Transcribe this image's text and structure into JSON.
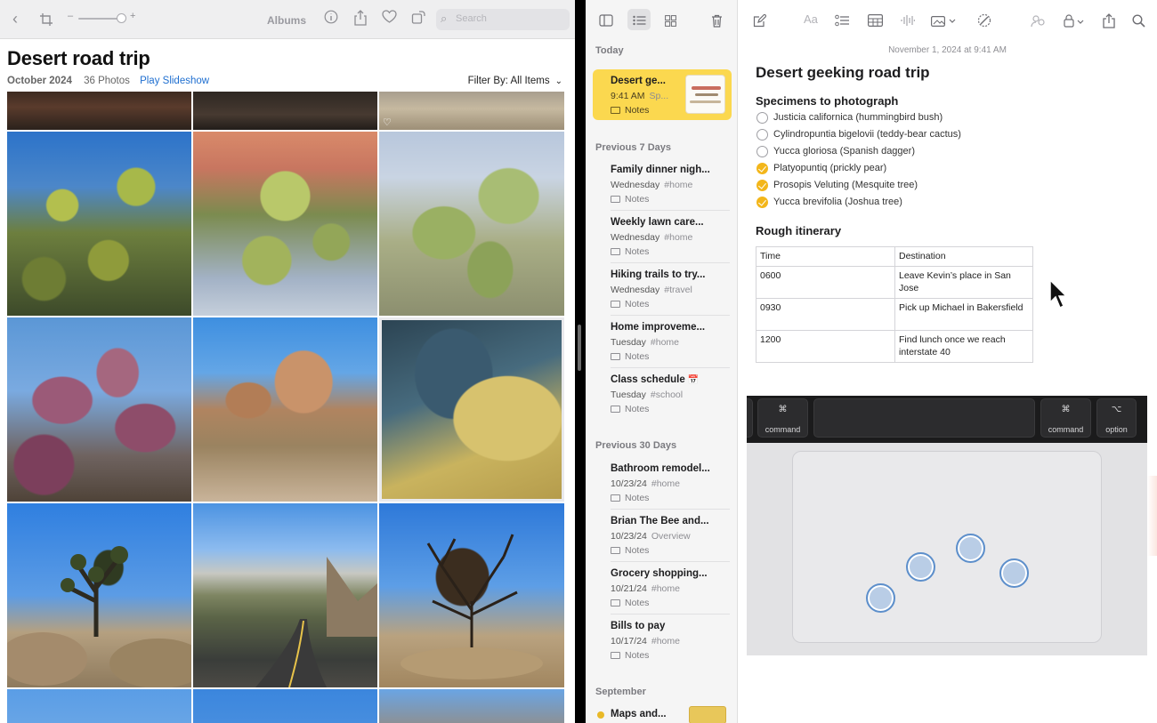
{
  "photos": {
    "toolbar": {
      "albums_label": "Albums",
      "search_placeholder": "Search"
    },
    "title": "Desert road trip",
    "date": "October 2024",
    "count": "36 Photos",
    "slideshow_label": "Play Slideshow",
    "filter_label": "Filter By: All Items"
  },
  "notes": {
    "sections": {
      "today": "Today",
      "prev7": "Previous 7 Days",
      "prev30": "Previous 30 Days",
      "september": "September"
    },
    "items": [
      {
        "title": "Desert ge...",
        "date": "9:41 AM",
        "tag": "Sp...",
        "folder": "Notes"
      },
      {
        "title": "Family dinner nigh...",
        "date": "Wednesday",
        "tag": "#home",
        "folder": "Notes"
      },
      {
        "title": "Weekly lawn care...",
        "date": "Wednesday",
        "tag": "#home",
        "folder": "Notes"
      },
      {
        "title": "Hiking trails to try...",
        "date": "Wednesday",
        "tag": "#travel",
        "folder": "Notes"
      },
      {
        "title": "Home improveme...",
        "date": "Tuesday",
        "tag": "#home",
        "folder": "Notes"
      },
      {
        "title": "Class schedule",
        "date": "Tuesday",
        "tag": "#school",
        "folder": "Notes"
      },
      {
        "title": "Bathroom remodel...",
        "date": "10/23/24",
        "tag": "#home",
        "folder": "Notes"
      },
      {
        "title": "Brian The Bee and...",
        "date": "10/23/24",
        "tag": "Overview",
        "folder": "Notes"
      },
      {
        "title": "Grocery shopping...",
        "date": "10/21/24",
        "tag": "#home",
        "folder": "Notes"
      },
      {
        "title": "Bills to pay",
        "date": "10/17/24",
        "tag": "#home",
        "folder": "Notes"
      },
      {
        "title": "Maps and...",
        "date": "",
        "tag": "",
        "folder": ""
      }
    ]
  },
  "editor": {
    "date": "November 1, 2024 at 9:41 AM",
    "title": "Desert geeking road trip",
    "specimens_heading": "Specimens to photograph",
    "checklist": [
      {
        "label": "Justicia californica (hummingbird bush)",
        "done": false
      },
      {
        "label": "Cylindropuntia bigelovii (teddy-bear cactus)",
        "done": false
      },
      {
        "label": "Yucca gloriosa (Spanish dagger)",
        "done": false
      },
      {
        "label": "Platyopuntiq (prickly pear)",
        "done": true
      },
      {
        "label": "Prosopis Veluting (Mesquite tree)",
        "done": true
      },
      {
        "label": "Yucca brevifolia (Joshua tree)",
        "done": true
      }
    ],
    "itinerary_heading": "Rough itinerary",
    "table": {
      "headers": [
        "Time",
        "Destination"
      ],
      "rows": [
        [
          "0600",
          "Leave Kevin’s place in San Jose"
        ],
        [
          "0930",
          "Pick up Michael in Bakersfield"
        ],
        [
          "1200",
          "Find lunch once we reach interstate 40"
        ]
      ]
    }
  },
  "keyboard": {
    "keys": [
      {
        "symbol": "⌘",
        "label": "command"
      },
      {
        "symbol": "⌘",
        "label": "command"
      },
      {
        "symbol": "⌥",
        "label": "option"
      }
    ]
  },
  "colors": {
    "accent_blue": "#1f6fd0",
    "notes_highlight": "#fbd84f",
    "checkbox_done": "#f3b61a"
  }
}
